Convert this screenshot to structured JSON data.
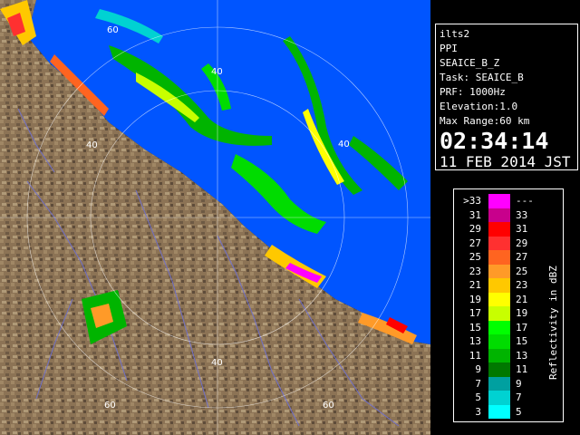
{
  "info": {
    "station": "ilts2",
    "product": "PPI",
    "scan": "SEAICE_B_Z",
    "task": "Task: SEAICE_B",
    "prf": "PRF: 1000Hz",
    "elevation": "Elevation:1.0",
    "max_range": "Max Range:60 km",
    "time": "02:34:14",
    "date": "11 FEB 2014 JST"
  },
  "range_labels": [
    "60",
    "40",
    "40",
    "40",
    "40",
    "60",
    "60"
  ],
  "legend": {
    "unit": "Reflectivity in dBZ",
    "rows": [
      {
        "lo": ">33",
        "hi": "---",
        "color": "#ff00ff"
      },
      {
        "lo": "31",
        "hi": "33",
        "color": "#c8008c"
      },
      {
        "lo": "29",
        "hi": "31",
        "color": "#ff0000"
      },
      {
        "lo": "27",
        "hi": "29",
        "color": "#ff3030"
      },
      {
        "lo": "25",
        "hi": "27",
        "color": "#ff6420"
      },
      {
        "lo": "23",
        "hi": "25",
        "color": "#ff9a28"
      },
      {
        "lo": "21",
        "hi": "23",
        "color": "#ffc800"
      },
      {
        "lo": "19",
        "hi": "21",
        "color": "#ffff00"
      },
      {
        "lo": "17",
        "hi": "19",
        "color": "#c8ff00"
      },
      {
        "lo": "15",
        "hi": "17",
        "color": "#00ff00"
      },
      {
        "lo": "13",
        "hi": "15",
        "color": "#00dc00"
      },
      {
        "lo": "11",
        "hi": "13",
        "color": "#00b400"
      },
      {
        "lo": "9",
        "hi": "11",
        "color": "#007800"
      },
      {
        "lo": "7",
        "hi": "9",
        "color": "#00a0a0"
      },
      {
        "lo": "5",
        "hi": "7",
        "color": "#00d2d2"
      },
      {
        "lo": "3",
        "hi": "5",
        "color": "#00ffff"
      }
    ]
  },
  "colors": {
    "sea": "#0055ff",
    "land": "#8c7355",
    "frame": "#ffffff",
    "range_ring": "#ffffff"
  }
}
